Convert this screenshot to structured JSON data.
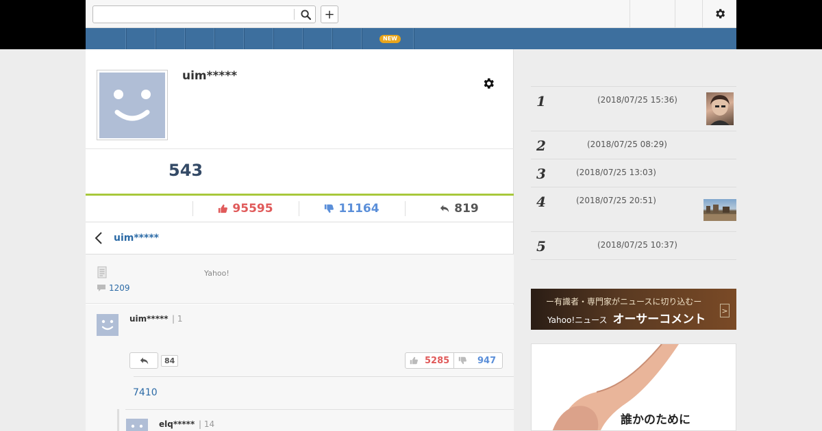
{
  "search": {
    "placeholder": "",
    "value": ""
  },
  "toolbar": {
    "plus_label": "+"
  },
  "nav": {
    "new_badge": "NEW"
  },
  "profile": {
    "username": "uim*****",
    "count": "543"
  },
  "stats": {
    "likes": "95595",
    "dislikes": "11164",
    "replies": "819",
    "colors": {
      "likes": "#e05a5a",
      "dislikes": "#5b8fd9",
      "replies": "#555555"
    }
  },
  "back_row": {
    "username": "uim*****"
  },
  "article": {
    "source": "Yahoo!",
    "comment_count": "1209"
  },
  "comment": {
    "user": "uim*****",
    "rank": "| 1",
    "reply_count": "84",
    "likes": "5285",
    "dislikes": "947",
    "replies_link": "7410"
  },
  "reply": {
    "user": "elq*****",
    "rank": "| 14"
  },
  "ranking": [
    {
      "num": "1",
      "date": "(2018/07/25 15:36)"
    },
    {
      "num": "2",
      "date": "(2018/07/25 08:29)"
    },
    {
      "num": "3",
      "date": "(2018/07/25 13:03)"
    },
    {
      "num": "4",
      "date": "(2018/07/25 20:51)"
    },
    {
      "num": "5",
      "date": "(2018/07/25 10:37)"
    }
  ],
  "banner": {
    "top_line": "ー有識者・専門家がニュースに切り込むー",
    "brand": "Yahoo!ニュース",
    "title": "オーサーコメント",
    "arrow": ">"
  },
  "ad": {
    "text": "誰かのために"
  },
  "colors": {
    "nav": "#3d6f9e",
    "accent_green": "#a7c83b",
    "link": "#2b6aa6"
  }
}
